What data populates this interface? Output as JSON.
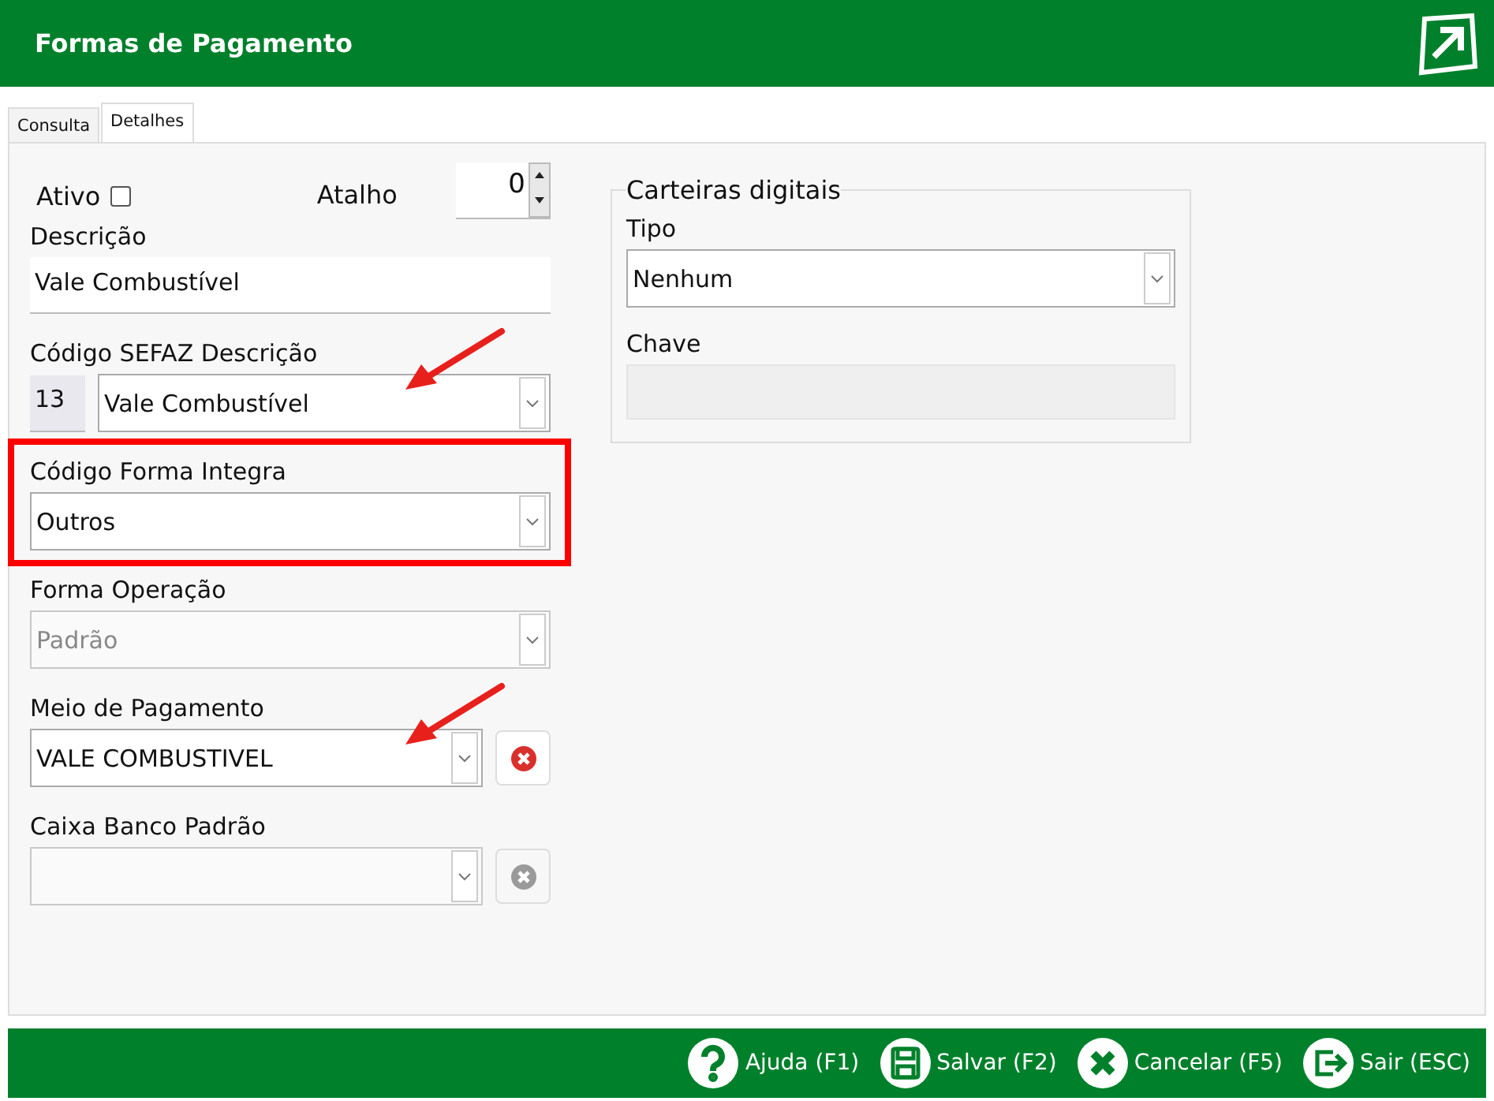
{
  "window": {
    "title": "Formas de Pagamento"
  },
  "tabs": [
    {
      "label": "Consulta",
      "selected": false
    },
    {
      "label": "Detalhes",
      "selected": true
    }
  ],
  "ativo": {
    "label": "Ativo",
    "checked": false
  },
  "atalho": {
    "label": "Atalho",
    "value": "0"
  },
  "fields": [
    {
      "kind": "text",
      "label": "Descrição",
      "value": "Vale Combustível",
      "disabled": false,
      "highlighted": false,
      "arrow": false
    },
    {
      "kind": "code_select",
      "label": "Código SEFAZ Descrição",
      "code": "13",
      "value": "Vale Combustível",
      "disabled": false,
      "highlighted": false,
      "arrow": true
    },
    {
      "kind": "select",
      "label": "Código Forma Integra",
      "value": "Outros",
      "disabled": false,
      "highlighted": true,
      "arrow": false
    },
    {
      "kind": "select",
      "label": "Forma Operação",
      "value": "Padrão",
      "disabled": true,
      "highlighted": false,
      "arrow": false
    },
    {
      "kind": "select_clear",
      "label": "Meio de Pagamento",
      "value": "VALE COMBUSTIVEL",
      "disabled": false,
      "highlighted": false,
      "arrow": true
    },
    {
      "kind": "select_clear",
      "label": "Caixa Banco Padrão",
      "disabled": true,
      "highlighted": false,
      "arrow": false
    }
  ],
  "wallets": {
    "legend": "Carteiras digitais",
    "fields": [
      {
        "kind": "select",
        "label": "Tipo",
        "value": "Nenhum"
      },
      {
        "kind": "readonly",
        "label": "Chave"
      }
    ]
  },
  "footer": [
    {
      "kind": "help",
      "label": "Ajuda (F1)"
    },
    {
      "kind": "save",
      "label": "Salvar (F2)"
    },
    {
      "kind": "cancel",
      "label": "Cancelar (F5)"
    },
    {
      "kind": "exit",
      "label": "Sair (ESC)"
    }
  ]
}
